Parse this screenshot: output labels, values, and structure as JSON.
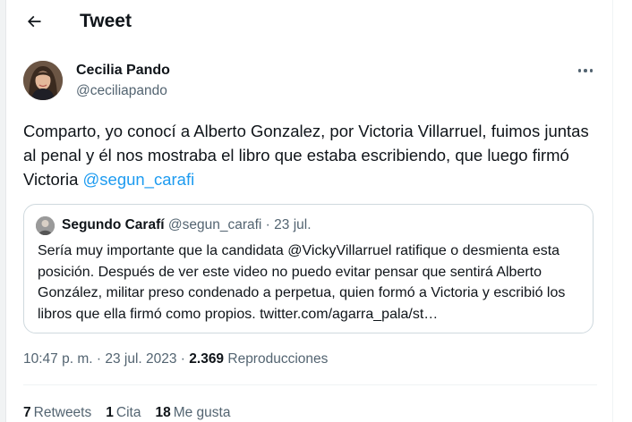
{
  "header": {
    "title": "Tweet"
  },
  "tweet": {
    "author_name": "Cecilia Pando",
    "author_handle": "@ceciliapando",
    "text_main": "Comparto, yo conocí a Alberto Gonzalez, por Victoria Villarruel, fuimos juntas al penal y él nos mostraba el libro que estaba escribiendo, que luego firmó Victoria ",
    "text_mention": "@segun_carafi",
    "quote": {
      "author_name": "Segundo Carafí",
      "author_handle": "@segun_carafi",
      "separator": " · ",
      "date": "23 jul.",
      "text": "Sería muy importante que la candidata @VickyVillarruel ratifique o desmienta esta posición. Después de ver este video no puedo evitar pensar que sentirá Alberto González, militar preso condenado a perpetua, quien formó a Victoria y escribió los libros que ella firmó como propios. twitter.com/agarra_pala/st…"
    },
    "time": "10:47 p. m.",
    "dot": " · ",
    "date": "23 jul. 2023",
    "views_count": "2.369",
    "views_label": "Reproducciones",
    "stats": {
      "retweets_count": "7",
      "retweets_label": "Retweets",
      "quotes_count": "1",
      "quotes_label": "Cita",
      "likes_count": "18",
      "likes_label": "Me gusta"
    }
  },
  "icons": {
    "back": "arrow-left-icon",
    "more": "more-horizontal-icon"
  },
  "colors": {
    "link": "#1d9bf0",
    "secondary_text": "#536471",
    "primary_text": "#0f1419",
    "border": "#cfd9de"
  }
}
